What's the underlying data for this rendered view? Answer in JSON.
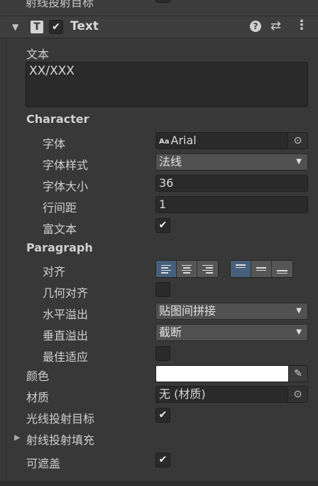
{
  "previous_component": {
    "label": "射线投射目标"
  },
  "header": {
    "arrow": "▼",
    "type_icon": "T",
    "enabled_check": "✔",
    "title": "Text",
    "help": "?",
    "preset": "⇄",
    "more": "⋮"
  },
  "text": {
    "label": "文本",
    "value": "XX/XXX"
  },
  "character": {
    "section_label": "Character",
    "font": {
      "label": "字体",
      "aa": "Aa",
      "value": "Arial",
      "picker": "⊙"
    },
    "font_style": {
      "label": "字体样式",
      "value": "法线",
      "caret": "▼"
    },
    "font_size": {
      "label": "字体大小",
      "value": "36"
    },
    "line_spacing": {
      "label": "行间距",
      "value": "1"
    },
    "rich_text": {
      "label": "富文本",
      "checked": "✔"
    }
  },
  "paragraph": {
    "section_label": "Paragraph",
    "alignment": {
      "label": "对齐",
      "horizontal_selected": "left",
      "vertical_selected": "top"
    },
    "align_by_geometry": {
      "label": "几何对齐",
      "checked": ""
    },
    "horizontal_overflow": {
      "label": "水平溢出",
      "value": "贴图间拼接",
      "caret": "▼"
    },
    "vertical_overflow": {
      "label": "垂直溢出",
      "value": "截断",
      "caret": "▼"
    },
    "best_fit": {
      "label": "最佳适应",
      "checked": ""
    }
  },
  "color": {
    "label": "颜色",
    "value_hex": "#ffffff",
    "eyedropper": "✎"
  },
  "material": {
    "label": "材质",
    "value": "无 (材质)",
    "picker": "⊙"
  },
  "raycast_target": {
    "label": "光线投射目标",
    "checked": "✔"
  },
  "raycast_padding": {
    "label": "射线投射填充",
    "arrow": "▶"
  },
  "maskable": {
    "label": "可遮盖",
    "checked": "✔"
  }
}
